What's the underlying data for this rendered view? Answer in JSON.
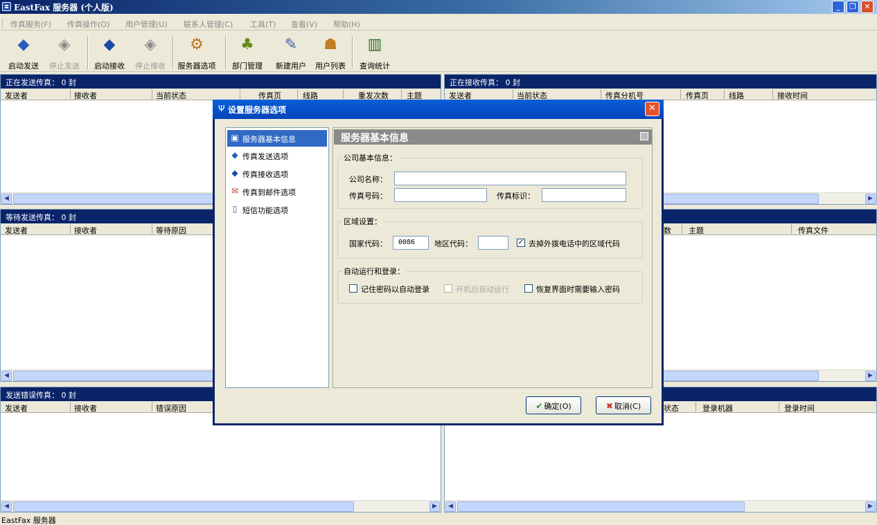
{
  "window": {
    "title": "EastFax 服务器 (个人版)"
  },
  "menu": [
    "传真服务(F)",
    "传真操作(O)",
    "用户管理(U)",
    "联系人管理(C)",
    "工具(T)",
    "查看(V)",
    "帮助(H)"
  ],
  "toolbar": [
    {
      "label": "启动发送",
      "icon": "send-arrow-icon",
      "enabled": true
    },
    {
      "label": "停止发送",
      "icon": "stop-send-icon",
      "enabled": false
    },
    {
      "label": "启动接收",
      "icon": "receive-arrow-icon",
      "enabled": true
    },
    {
      "label": "停止接收",
      "icon": "stop-receive-icon",
      "enabled": false
    },
    {
      "label": "服务器选项",
      "icon": "server-options-icon",
      "enabled": true
    },
    {
      "label": "部门管理",
      "icon": "department-icon",
      "enabled": true
    },
    {
      "label": "新建用户",
      "icon": "new-user-icon",
      "enabled": true
    },
    {
      "label": "用户列表",
      "icon": "user-list-icon",
      "enabled": true
    },
    {
      "label": "查询统计",
      "icon": "statistics-chart-icon",
      "enabled": true
    }
  ],
  "panes": {
    "sending": {
      "title": "正在发送传真： 0 封",
      "columns": [
        "发送者",
        "接收者",
        "当前状态",
        "传真页",
        "线路",
        "重发次数",
        "主题"
      ]
    },
    "receiving": {
      "title": "正在接收传真： 0 封",
      "columns": [
        "发送者",
        "当前状态",
        "传真分机号",
        "传真页",
        "线路",
        "接收时间"
      ]
    },
    "waiting": {
      "title": "等待发送传真： 0 封",
      "columns": [
        "发送者",
        "接收者",
        "等待原因"
      ]
    },
    "waiting_right": {
      "columns": [
        "数",
        "主题",
        "传真文件"
      ]
    },
    "errors": {
      "title": "发送错误传真： 0 封",
      "columns": [
        "发送者",
        "接收者",
        "错误原因"
      ]
    },
    "users_right": {
      "columns": [
        "状态",
        "登录机器",
        "登录时间"
      ]
    }
  },
  "dialog": {
    "title": "设置服务器选项",
    "nav": [
      {
        "label": "服务器基本信息",
        "icon": "server-info-icon",
        "selected": true
      },
      {
        "label": "传真发送选项",
        "icon": "fax-send-icon",
        "selected": false
      },
      {
        "label": "传真接收选项",
        "icon": "fax-receive-icon",
        "selected": false
      },
      {
        "label": "传真到邮件选项",
        "icon": "envelope-icon",
        "selected": false
      },
      {
        "label": "短信功能选项",
        "icon": "mobile-phone-icon",
        "selected": false
      }
    ],
    "panel_title": "服务器基本信息",
    "company": {
      "legend": "公司基本信息：",
      "name_label": "公司名称：",
      "name_value": "",
      "fax_number_label": "传真号码：",
      "fax_number_value": "",
      "fax_id_label": "传真标识：",
      "fax_id_value": ""
    },
    "region": {
      "legend": "区域设置：",
      "country_label": "国家代码：",
      "country_value": "0086",
      "area_label": "地区代码：",
      "area_value": "",
      "strip_label": "去掉外拨电话中的区域代码",
      "strip_checked": true
    },
    "autorun": {
      "legend": "自动运行和登录：",
      "remember_label": "记住密码以自动登录",
      "remember_checked": false,
      "startup_label": "开机后自动运行",
      "startup_checked": false,
      "startup_enabled": false,
      "restore_label": "恢复界面时需要输入密码",
      "restore_checked": false
    },
    "ok_label": "确定(O)",
    "cancel_label": "取消(C)"
  },
  "status": "EastFax 服务器"
}
